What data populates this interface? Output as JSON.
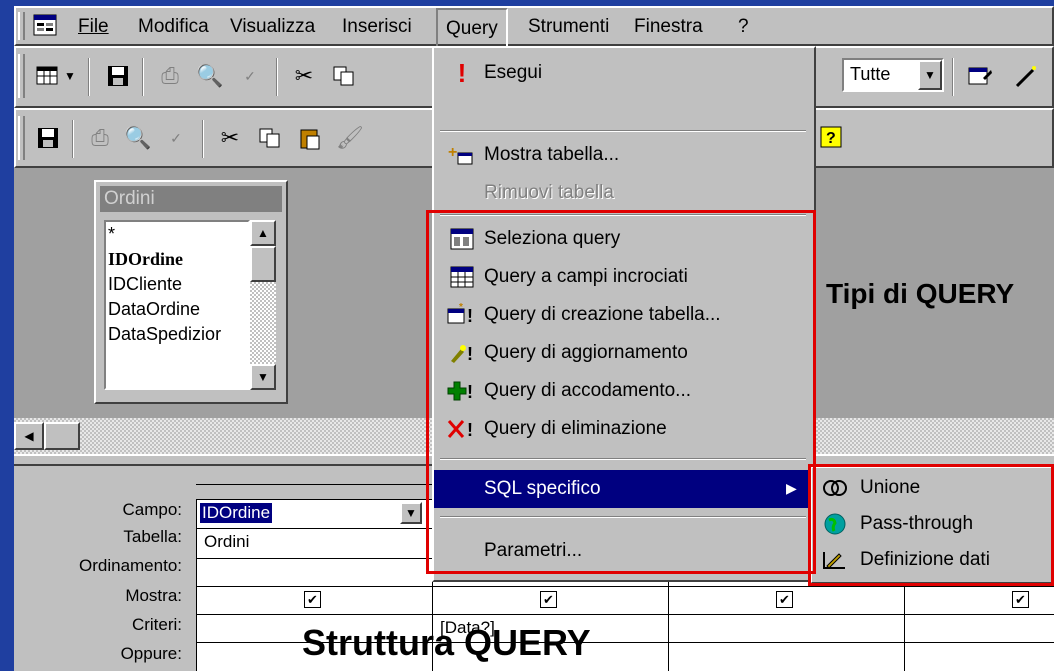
{
  "menubar": {
    "items": [
      {
        "label": "File"
      },
      {
        "label": "Modifica"
      },
      {
        "label": "Visualizza"
      },
      {
        "label": "Inserisci"
      },
      {
        "label": "Query"
      },
      {
        "label": "Strumenti"
      },
      {
        "label": "Finestra"
      },
      {
        "label": "?"
      }
    ]
  },
  "toolbar1": {
    "combo_value": "Tutte"
  },
  "field_list": {
    "title": "Ordini",
    "fields": [
      "*",
      "IDOrdine",
      "IDCliente",
      "DataOrdine",
      "DataSpedizior"
    ]
  },
  "grid": {
    "row_labels": [
      "Campo:",
      "Tabella:",
      "Ordinamento:",
      "Mostra:",
      "Criteri:",
      "Oppure:"
    ],
    "col1_campo": "IDOrdine",
    "col1_tabella": "Ordini",
    "col2_criteri": "[Data?]"
  },
  "query_menu": {
    "items": [
      {
        "label": "Esegui",
        "icon": "exclamation-icon"
      },
      {
        "label": "Mostra tabella...",
        "icon": "show-table-icon"
      },
      {
        "label": "Rimuovi tabella",
        "icon": "",
        "disabled": true
      },
      {
        "label": "Seleziona query",
        "icon": "select-query-icon"
      },
      {
        "label": "Query a campi incrociati",
        "icon": "crosstab-query-icon"
      },
      {
        "label": "Query di creazione tabella...",
        "icon": "make-table-query-icon"
      },
      {
        "label": "Query di aggiornamento",
        "icon": "update-query-icon"
      },
      {
        "label": "Query di accodamento...",
        "icon": "append-query-icon"
      },
      {
        "label": "Query di eliminazione",
        "icon": "delete-query-icon"
      },
      {
        "label": "SQL specifico",
        "icon": "",
        "highlighted": true
      },
      {
        "label": "Parametri...",
        "icon": ""
      }
    ]
  },
  "sql_submenu": {
    "items": [
      {
        "label": "Unione",
        "icon": "union-icon"
      },
      {
        "label": "Pass-through",
        "icon": "globe-icon"
      },
      {
        "label": "Definizione dati",
        "icon": "data-definition-icon"
      }
    ]
  },
  "annotations": {
    "types": "Tipi di QUERY",
    "structure": "Struttura QUERY"
  },
  "colors": {
    "highlight": "#000080",
    "annotation_box": "#e00000",
    "face": "#c0c0c0"
  }
}
